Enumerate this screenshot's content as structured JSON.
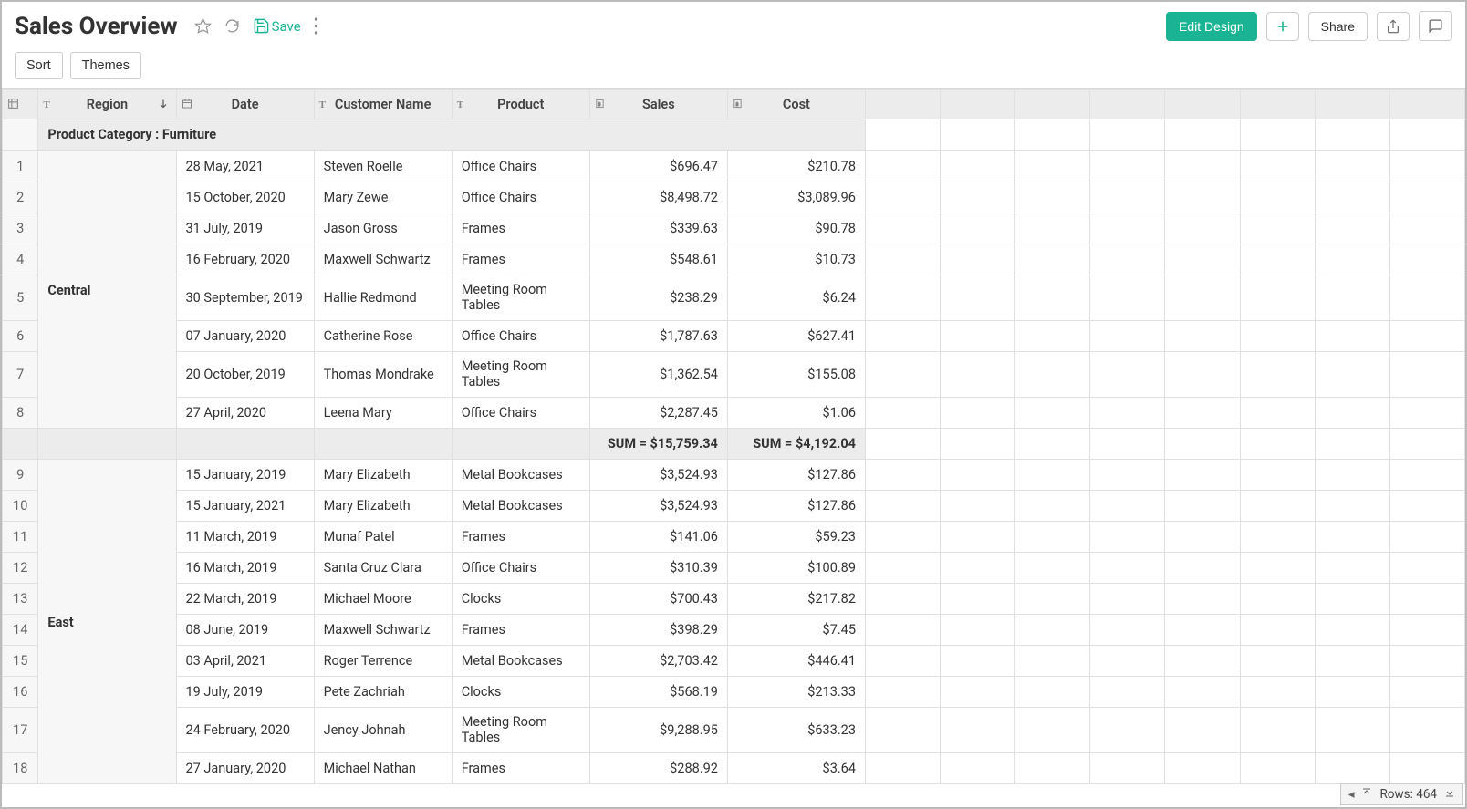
{
  "header": {
    "title": "Sales Overview",
    "save_label": "Save",
    "edit_design": "Edit Design",
    "share": "Share"
  },
  "toolbar": {
    "sort": "Sort",
    "themes": "Themes"
  },
  "columns": {
    "region": "Region",
    "date": "Date",
    "customer": "Customer Name",
    "product": "Product",
    "sales": "Sales",
    "cost": "Cost"
  },
  "group_label": "Product Category : Furniture",
  "regions": {
    "central": "Central",
    "east": "East"
  },
  "rows_central": [
    {
      "n": "1",
      "date": "28 May, 2021",
      "cust": "Steven Roelle",
      "prod": "Office Chairs",
      "sales": "$696.47",
      "cost": "$210.78"
    },
    {
      "n": "2",
      "date": "15 October, 2020",
      "cust": "Mary Zewe",
      "prod": "Office Chairs",
      "sales": "$8,498.72",
      "cost": "$3,089.96"
    },
    {
      "n": "3",
      "date": "31 July, 2019",
      "cust": "Jason Gross",
      "prod": "Frames",
      "sales": "$339.63",
      "cost": "$90.78"
    },
    {
      "n": "4",
      "date": "16 February, 2020",
      "cust": "Maxwell Schwartz",
      "prod": "Frames",
      "sales": "$548.61",
      "cost": "$10.73"
    },
    {
      "n": "5",
      "date": "30 September, 2019",
      "cust": "Hallie Redmond",
      "prod": "Meeting Room Tables",
      "sales": "$238.29",
      "cost": "$6.24",
      "multi": true
    },
    {
      "n": "6",
      "date": "07 January, 2020",
      "cust": "Catherine Rose",
      "prod": "Office Chairs",
      "sales": "$1,787.63",
      "cost": "$627.41"
    },
    {
      "n": "7",
      "date": "20 October, 2019",
      "cust": "Thomas Mondrake",
      "prod": "Meeting Room Tables",
      "sales": "$1,362.54",
      "cost": "$155.08",
      "multi": true
    },
    {
      "n": "8",
      "date": "27 April, 2020",
      "cust": "Leena Mary",
      "prod": "Office Chairs",
      "sales": "$2,287.45",
      "cost": "$1.06"
    }
  ],
  "sum_central": {
    "sales": "SUM = $15,759.34",
    "cost": "SUM = $4,192.04"
  },
  "rows_east": [
    {
      "n": "9",
      "date": "15 January, 2019",
      "cust": "Mary Elizabeth",
      "prod": "Metal Bookcases",
      "sales": "$3,524.93",
      "cost": "$127.86"
    },
    {
      "n": "10",
      "date": "15 January, 2021",
      "cust": "Mary Elizabeth",
      "prod": "Metal Bookcases",
      "sales": "$3,524.93",
      "cost": "$127.86"
    },
    {
      "n": "11",
      "date": "11 March, 2019",
      "cust": "Munaf Patel",
      "prod": "Frames",
      "sales": "$141.06",
      "cost": "$59.23"
    },
    {
      "n": "12",
      "date": "16 March, 2019",
      "cust": "Santa Cruz Clara",
      "prod": "Office Chairs",
      "sales": "$310.39",
      "cost": "$100.89"
    },
    {
      "n": "13",
      "date": "22 March, 2019",
      "cust": "Michael Moore",
      "prod": "Clocks",
      "sales": "$700.43",
      "cost": "$217.82"
    },
    {
      "n": "14",
      "date": "08 June, 2019",
      "cust": "Maxwell Schwartz",
      "prod": "Frames",
      "sales": "$398.29",
      "cost": "$7.45"
    },
    {
      "n": "15",
      "date": "03 April, 2021",
      "cust": "Roger Terrence",
      "prod": "Metal Bookcases",
      "sales": "$2,703.42",
      "cost": "$446.41"
    },
    {
      "n": "16",
      "date": "19 July, 2019",
      "cust": "Pete Zachriah",
      "prod": "Clocks",
      "sales": "$568.19",
      "cost": "$213.33"
    },
    {
      "n": "17",
      "date": "24 February, 2020",
      "cust": "Jency Johnah",
      "prod": "Meeting Room Tables",
      "sales": "$9,288.95",
      "cost": "$633.23",
      "multi": true
    },
    {
      "n": "18",
      "date": "27 January, 2020",
      "cust": "Michael Nathan",
      "prod": "Frames",
      "sales": "$288.92",
      "cost": "$3.64"
    }
  ],
  "footer": {
    "rows_label": "Rows: 464"
  }
}
